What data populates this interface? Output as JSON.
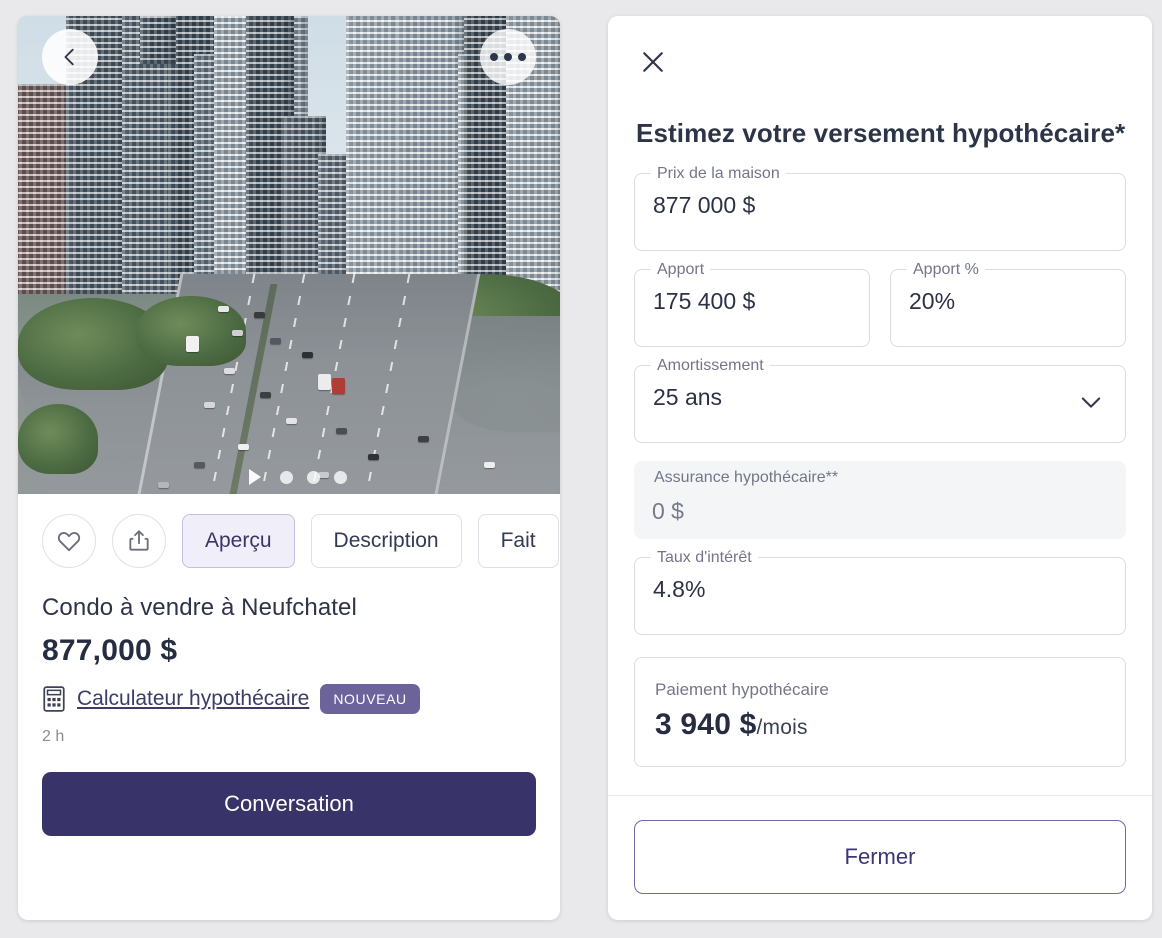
{
  "theme": {
    "page_bg": "#e9e9eb",
    "primary": "#383368",
    "accent_light": "#f0eff9",
    "badge_purple": "#6b6399",
    "text_dark": "#2d3448",
    "text_muted": "#73768a",
    "border": "#dcdde3"
  },
  "listing": {
    "hero": {
      "back_icon": "chevron-left-icon",
      "more_icon": "more-horizontal-icon",
      "play_icon": "play-icon",
      "carousel_dot_count": 3
    },
    "actions": {
      "favorite_icon": "heart-icon",
      "share_icon": "share-icon",
      "chips": [
        {
          "label": "Aperçu",
          "selected": true
        },
        {
          "label": "Description",
          "selected": false
        },
        {
          "label": "Fait",
          "selected": false
        }
      ]
    },
    "title": "Condo à vendre à Neufchatel",
    "price": "877,000 $",
    "calculator": {
      "icon": "calculator-icon",
      "link_label": "Calculateur hypothécaire",
      "badge": "NOUVEAU"
    },
    "timestamp": "2 h",
    "primary_button": "Conversation"
  },
  "modal": {
    "close_icon": "close-icon",
    "title": "Estimez votre versement hypothécaire*",
    "fields": {
      "home_price": {
        "label": "Prix de la maison",
        "value": "877 000 $"
      },
      "down_payment": {
        "label": "Apport",
        "value": "175 400 $"
      },
      "down_payment_pct": {
        "label": "Apport %",
        "value": "20%"
      },
      "amortization": {
        "label": "Amortissement",
        "value": "25 ans",
        "icon": "chevron-down-icon"
      },
      "mortgage_insurance": {
        "label": "Assurance hypothécaire**",
        "value": "0 $",
        "disabled": true
      },
      "interest_rate": {
        "label": "Taux d'intérêt",
        "value": "4.8%"
      }
    },
    "result": {
      "label": "Paiement hypothécaire",
      "amount": "3 940 $",
      "period": "/mois"
    },
    "close_button": "Fermer"
  }
}
